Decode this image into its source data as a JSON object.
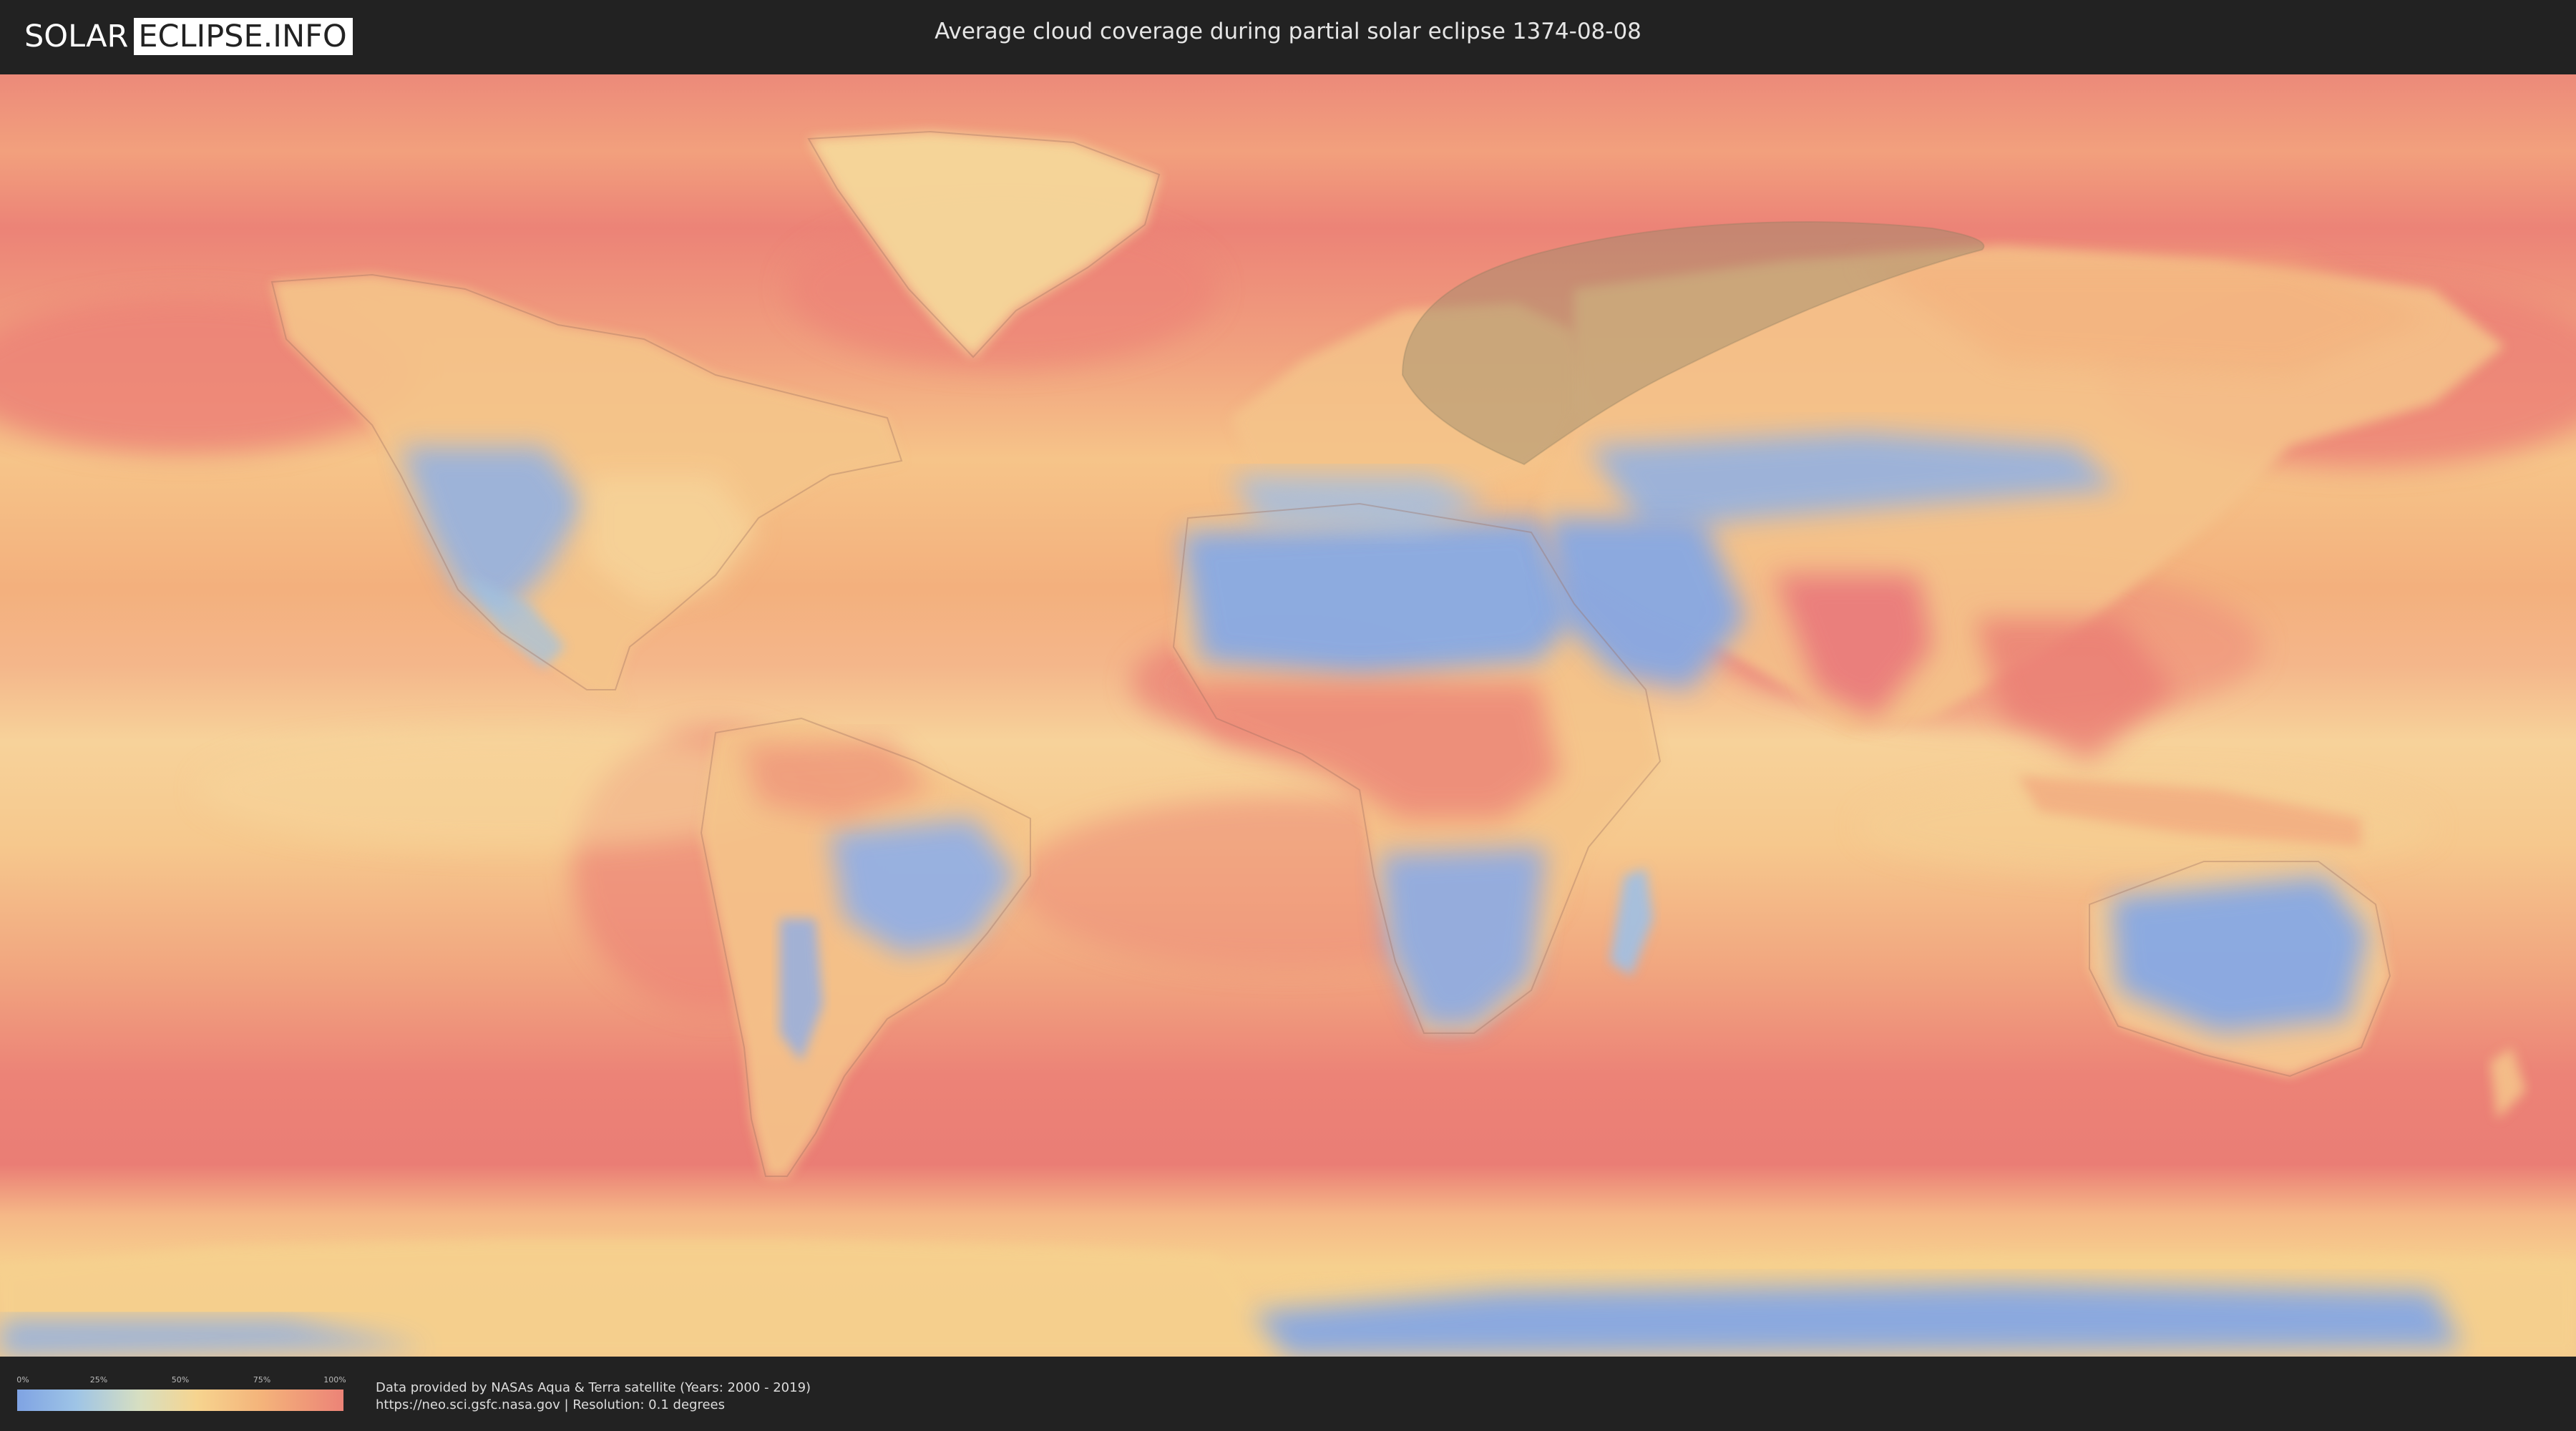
{
  "header": {
    "logo_left": "SOLAR",
    "logo_right": "ECLIPSE.INFO",
    "title": "Average cloud coverage during partial solar eclipse 1374-08-08"
  },
  "map": {
    "type": "world cloud coverage map",
    "projection": "equirectangular",
    "eclipse_overlay": "partial eclipse visibility region over Scandinavia, northern Russia and the Arctic",
    "colors": {
      "low": "#7fa3e3",
      "mid_low": "#9ec4e6",
      "mid": "#f6d48f",
      "high": "#ec8377",
      "eclipse_region": "#9a8a6a"
    }
  },
  "legend": {
    "ticks": [
      "0%",
      "25%",
      "50%",
      "75%",
      "100%"
    ]
  },
  "footer": {
    "line1": "Data provided by NASAs Aqua & Terra satellite (Years: 2000 - 2019)",
    "line2": "https://neo.sci.gsfc.nasa.gov | Resolution: 0.1 degrees"
  }
}
